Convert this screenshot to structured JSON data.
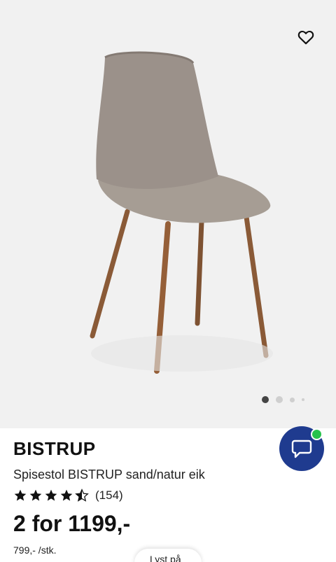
{
  "product": {
    "brand": "BISTRUP",
    "subtitle": "Spisestol BISTRUP sand/natur eik",
    "rating": 4.5,
    "reviews_count": "(154)",
    "price": "2 for 1199,-",
    "unit_price": "799,- /stk."
  },
  "gallery": {
    "image_count": 4,
    "active_index": 0
  },
  "floating_pill": {
    "label": "Lyst på"
  },
  "icons": {
    "favorite": "heart-outline-icon",
    "chat": "chat-bubble-icon",
    "star": "star-icon"
  },
  "colors": {
    "chat_button": "#1f3b8f",
    "online_indicator": "#27c24c",
    "gallery_background": "#f1f1f1"
  }
}
